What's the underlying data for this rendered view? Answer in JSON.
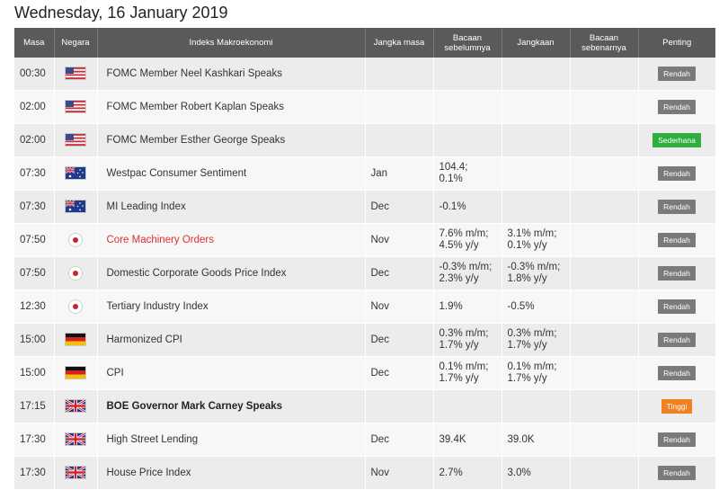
{
  "page": {
    "date_title": "Wednesday, 16 January 2019"
  },
  "headers": {
    "time": "Masa",
    "country": "Negara",
    "index": "Indeks Makroekonomi",
    "period": "Jangka masa",
    "prev_l1": "Bacaan",
    "prev_l2": "sebelumnya",
    "forecast": "Jangkaan",
    "actual_l1": "Bacaan",
    "actual_l2": "sebenarnya",
    "importance": "Penting"
  },
  "colors": {
    "header_bg": "#5a5a5a",
    "row_even": "#ececec",
    "row_odd": "#f7f7f7",
    "rendah": "#7a7a7a",
    "sederhana": "#2fae3f",
    "tinggi": "#f08020",
    "highlight_text": "#e03030"
  },
  "rows": [
    {
      "time": "00:30",
      "country_icon": "us-flag-icon",
      "name": "FOMC Member Neel Kashkari Speaks",
      "period": "",
      "prev_1": "",
      "prev_2": "",
      "fc_1": "",
      "fc_2": "",
      "actual": "",
      "importance": "Rendah"
    },
    {
      "time": "02:00",
      "country_icon": "us-flag-icon",
      "name": "FOMC Member Robert Kaplan Speaks",
      "period": "",
      "prev_1": "",
      "prev_2": "",
      "fc_1": "",
      "fc_2": "",
      "actual": "",
      "importance": "Rendah"
    },
    {
      "time": "02:00",
      "country_icon": "us-flag-icon",
      "name": "FOMC Member Esther George Speaks",
      "period": "",
      "prev_1": "",
      "prev_2": "",
      "fc_1": "",
      "fc_2": "",
      "actual": "",
      "importance": "Sederhana"
    },
    {
      "time": "07:30",
      "country_icon": "au-flag-icon",
      "name": "Westpac Consumer Sentiment",
      "period": "Jan",
      "prev_1": "104.4;",
      "prev_2": "0.1%",
      "fc_1": "",
      "fc_2": "",
      "actual": "",
      "importance": "Rendah"
    },
    {
      "time": "07:30",
      "country_icon": "au-flag-icon",
      "name": "MI Leading Index",
      "period": "Dec",
      "prev_1": "-0.1%",
      "prev_2": "",
      "fc_1": "",
      "fc_2": "",
      "actual": "",
      "importance": "Rendah"
    },
    {
      "time": "07:50",
      "country_icon": "jp-flag-icon",
      "name": "Core Machinery Orders",
      "period": "Nov",
      "prev_1": "7.6% m/m;",
      "prev_2": "4.5% y/y",
      "fc_1": "3.1% m/m;",
      "fc_2": "0.1% y/y",
      "actual": "",
      "importance": "Rendah"
    },
    {
      "time": "07:50",
      "country_icon": "jp-flag-icon",
      "name": "Domestic Corporate Goods Price Index",
      "period": "Dec",
      "prev_1": "-0.3% m/m;",
      "prev_2": "2.3% y/y",
      "fc_1": "-0.3% m/m;",
      "fc_2": "1.8% y/y",
      "actual": "",
      "importance": "Rendah"
    },
    {
      "time": "12:30",
      "country_icon": "jp-flag-icon",
      "name": "Tertiary Industry Index",
      "period": "Nov",
      "prev_1": "1.9%",
      "prev_2": "",
      "fc_1": "-0.5%",
      "fc_2": "",
      "actual": "",
      "importance": "Rendah"
    },
    {
      "time": "15:00",
      "country_icon": "de-flag-icon",
      "name": "Harmonized CPI",
      "period": "Dec",
      "prev_1": "0.3% m/m;",
      "prev_2": "1.7% y/y",
      "fc_1": "0.3% m/m;",
      "fc_2": "1.7% y/y",
      "actual": "",
      "importance": "Rendah"
    },
    {
      "time": "15:00",
      "country_icon": "de-flag-icon",
      "name": "CPI",
      "period": "Dec",
      "prev_1": "0.1% m/m;",
      "prev_2": "1.7% y/y",
      "fc_1": "0.1% m/m;",
      "fc_2": "1.7% y/y",
      "actual": "",
      "importance": "Rendah"
    },
    {
      "time": "17:15",
      "country_icon": "uk-flag-icon",
      "name": "BOE Governor Mark Carney Speaks",
      "period": "",
      "prev_1": "",
      "prev_2": "",
      "fc_1": "",
      "fc_2": "",
      "actual": "",
      "importance": "Tinggi"
    },
    {
      "time": "17:30",
      "country_icon": "uk-flag-icon",
      "name": "High Street Lending",
      "period": "Dec",
      "prev_1": "39.4K",
      "prev_2": "",
      "fc_1": "39.0K",
      "fc_2": "",
      "actual": "",
      "importance": "Rendah"
    },
    {
      "time": "17:30",
      "country_icon": "uk-flag-icon",
      "name": "House Price Index",
      "period": "Nov",
      "prev_1": "2.7%",
      "prev_2": "",
      "fc_1": "3.0%",
      "fc_2": "",
      "actual": "",
      "importance": "Rendah"
    }
  ]
}
